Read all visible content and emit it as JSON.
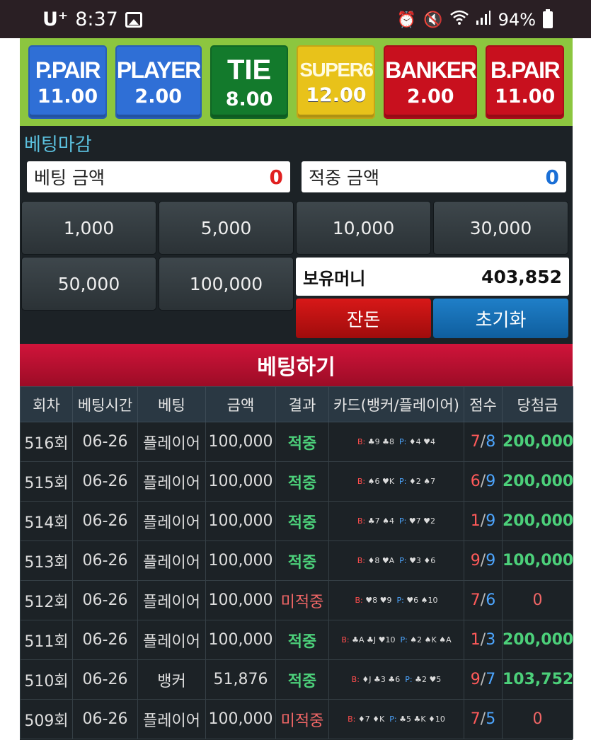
{
  "status_bar": {
    "carrier": "U⁺",
    "time": "8:37",
    "battery": "94%",
    "icons": [
      "image-icon",
      "alarm-icon",
      "mute-icon",
      "wifi-icon",
      "signal-icon",
      "battery-icon"
    ]
  },
  "odds": [
    {
      "label": "P.PAIR",
      "value": "11.00",
      "color": "#2f6fd6"
    },
    {
      "label": "PLAYER",
      "value": "2.00",
      "color": "#2f6fd6"
    },
    {
      "label": "TIE",
      "value": "8.00",
      "color": "#137a2c"
    },
    {
      "label": "SUPER6",
      "value": "12.00",
      "color": "#e8c21a"
    },
    {
      "label": "BANKER",
      "value": "2.00",
      "color": "#c8101e"
    },
    {
      "label": "B.PAIR",
      "value": "11.00",
      "color": "#c8101e"
    }
  ],
  "betting_status": "베팅마감",
  "bet_amount": {
    "label": "베팅 금액",
    "value": "0"
  },
  "hit_amount": {
    "label": "적중 금액",
    "value": "0"
  },
  "chips": [
    "1,000",
    "5,000",
    "10,000",
    "30,000",
    "50,000",
    "100,000"
  ],
  "money": {
    "label": "보유머니",
    "value": "403,852"
  },
  "buttons": {
    "change": "잔돈",
    "reset": "초기화",
    "bet": "베팅하기"
  },
  "table": {
    "headers": [
      "회차",
      "베팅시간",
      "베팅",
      "금액",
      "결과",
      "카드(뱅커/플레이어)",
      "점수",
      "당첨금"
    ],
    "rows": [
      {
        "round": "516회",
        "time": "06-26",
        "bet": "플레이어",
        "amount": "100,000",
        "result": "적중",
        "banker_cards": "♣9 ♣8",
        "player_cards": "♦4 ♥4",
        "score_b": "7",
        "score_p": "8",
        "payout": "200,000"
      },
      {
        "round": "515회",
        "time": "06-26",
        "bet": "플레이어",
        "amount": "100,000",
        "result": "적중",
        "banker_cards": "♠6 ♥K",
        "player_cards": "♦2 ♠7",
        "score_b": "6",
        "score_p": "9",
        "payout": "200,000"
      },
      {
        "round": "514회",
        "time": "06-26",
        "bet": "플레이어",
        "amount": "100,000",
        "result": "적중",
        "banker_cards": "♣7 ♠4",
        "player_cards": "♥7 ♥2",
        "score_b": "1",
        "score_p": "9",
        "payout": "200,000"
      },
      {
        "round": "513회",
        "time": "06-26",
        "bet": "플레이어",
        "amount": "100,000",
        "result": "적중",
        "banker_cards": "♦8 ♥A",
        "player_cards": "♥3 ♦6",
        "score_b": "9",
        "score_p": "9",
        "payout": "100,000"
      },
      {
        "round": "512회",
        "time": "06-26",
        "bet": "플레이어",
        "amount": "100,000",
        "result": "미적중",
        "banker_cards": "♥8 ♥9",
        "player_cards": "♥6 ♠10",
        "score_b": "7",
        "score_p": "6",
        "payout": "0"
      },
      {
        "round": "511회",
        "time": "06-26",
        "bet": "플레이어",
        "amount": "100,000",
        "result": "적중",
        "banker_cards": "♣A ♣J ♥10",
        "player_cards": "♠2 ♠K ♠A",
        "score_b": "1",
        "score_p": "3",
        "payout": "200,000"
      },
      {
        "round": "510회",
        "time": "06-26",
        "bet": "뱅커",
        "amount": "51,876",
        "result": "적중",
        "banker_cards": "♦J ♣3 ♣6",
        "player_cards": "♣2 ♥5",
        "score_b": "9",
        "score_p": "7",
        "payout": "103,752"
      },
      {
        "round": "509회",
        "time": "06-26",
        "bet": "플레이어",
        "amount": "100,000",
        "result": "미적중",
        "banker_cards": "♦7 ♦K",
        "player_cards": "♣5 ♣K ♦10",
        "score_b": "7",
        "score_p": "5",
        "payout": "0"
      }
    ]
  }
}
